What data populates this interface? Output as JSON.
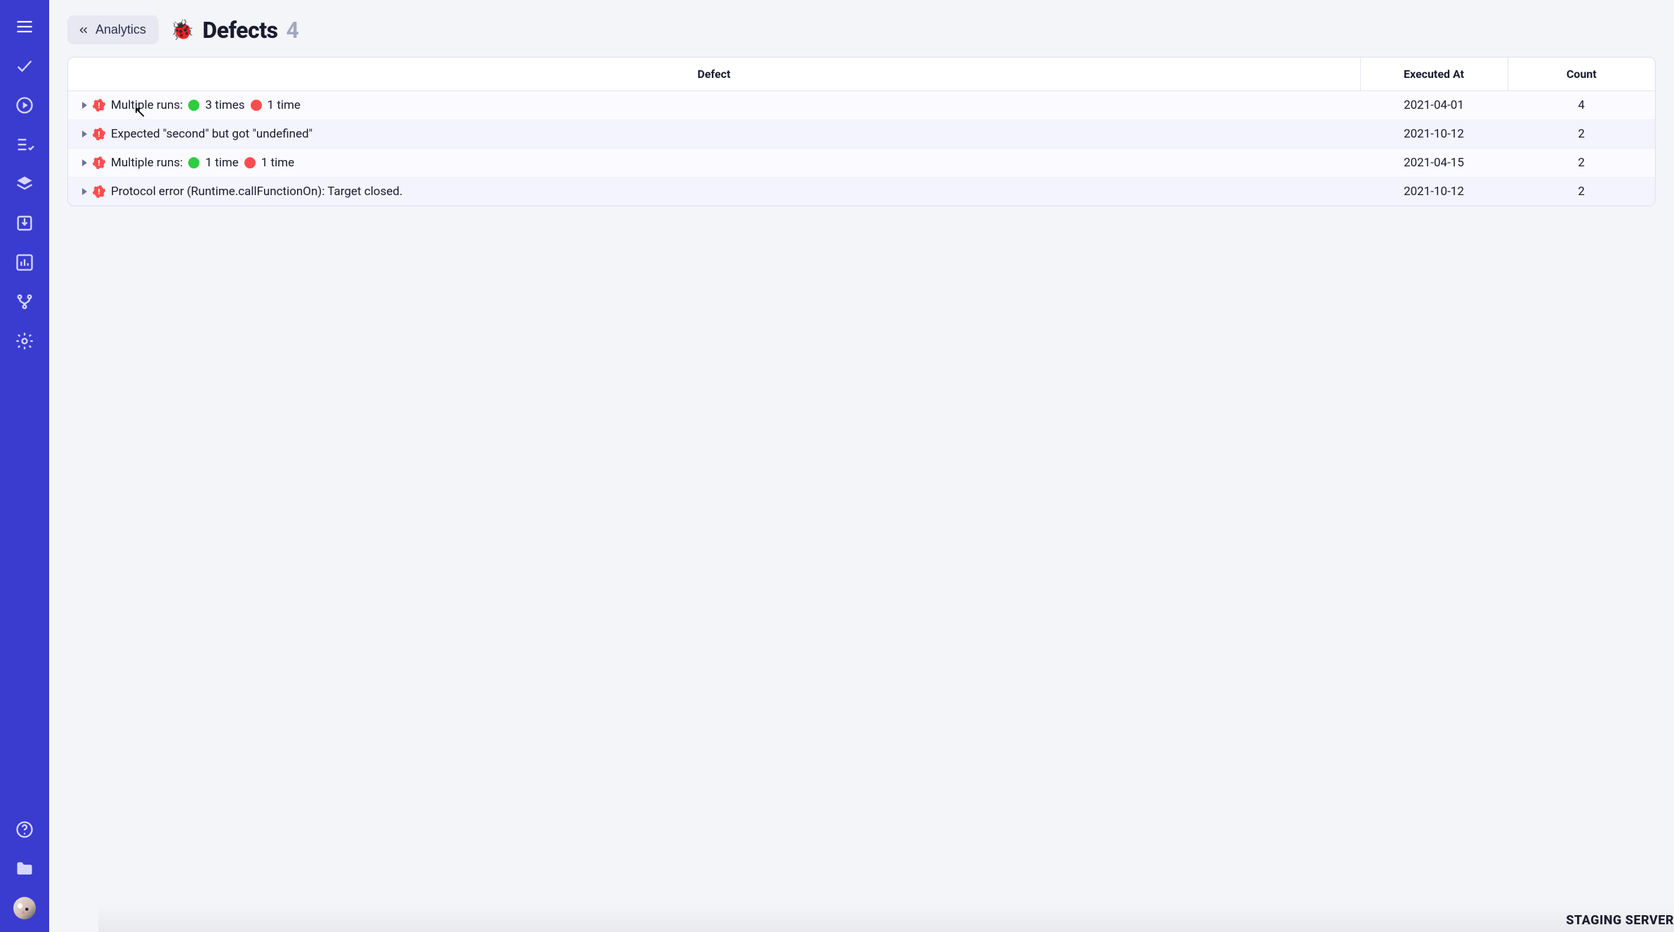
{
  "breadcrumb": {
    "label": "Analytics"
  },
  "page": {
    "icon": "🐞",
    "title": "Defects",
    "count": "4"
  },
  "columns": {
    "defect": "Defect",
    "executed": "Executed At",
    "count": "Count"
  },
  "rows": [
    {
      "type": "multi",
      "prefix": "Multiple runs:",
      "green": "3 times",
      "red": "1 time",
      "executed": "2021-04-01",
      "count": "4"
    },
    {
      "type": "text",
      "text": "Expected \"second\" but got \"undefined\"",
      "executed": "2021-10-12",
      "count": "2"
    },
    {
      "type": "multi",
      "prefix": "Multiple runs:",
      "green": "1 time",
      "red": "1 time",
      "executed": "2021-04-15",
      "count": "2"
    },
    {
      "type": "text",
      "text": "Protocol error (Runtime.callFunctionOn): Target closed.",
      "executed": "2021-10-12",
      "count": "2"
    }
  ],
  "footer": {
    "mark": "STAGING SERVER"
  },
  "sidebar": {
    "top": [
      "hamburger-icon",
      "check-icon",
      "play-icon",
      "checklist-icon",
      "layers-icon",
      "import-icon",
      "chart-icon",
      "branch-icon",
      "gear-icon"
    ],
    "bottom": [
      "help-icon",
      "folder-icon",
      "avatar"
    ]
  }
}
